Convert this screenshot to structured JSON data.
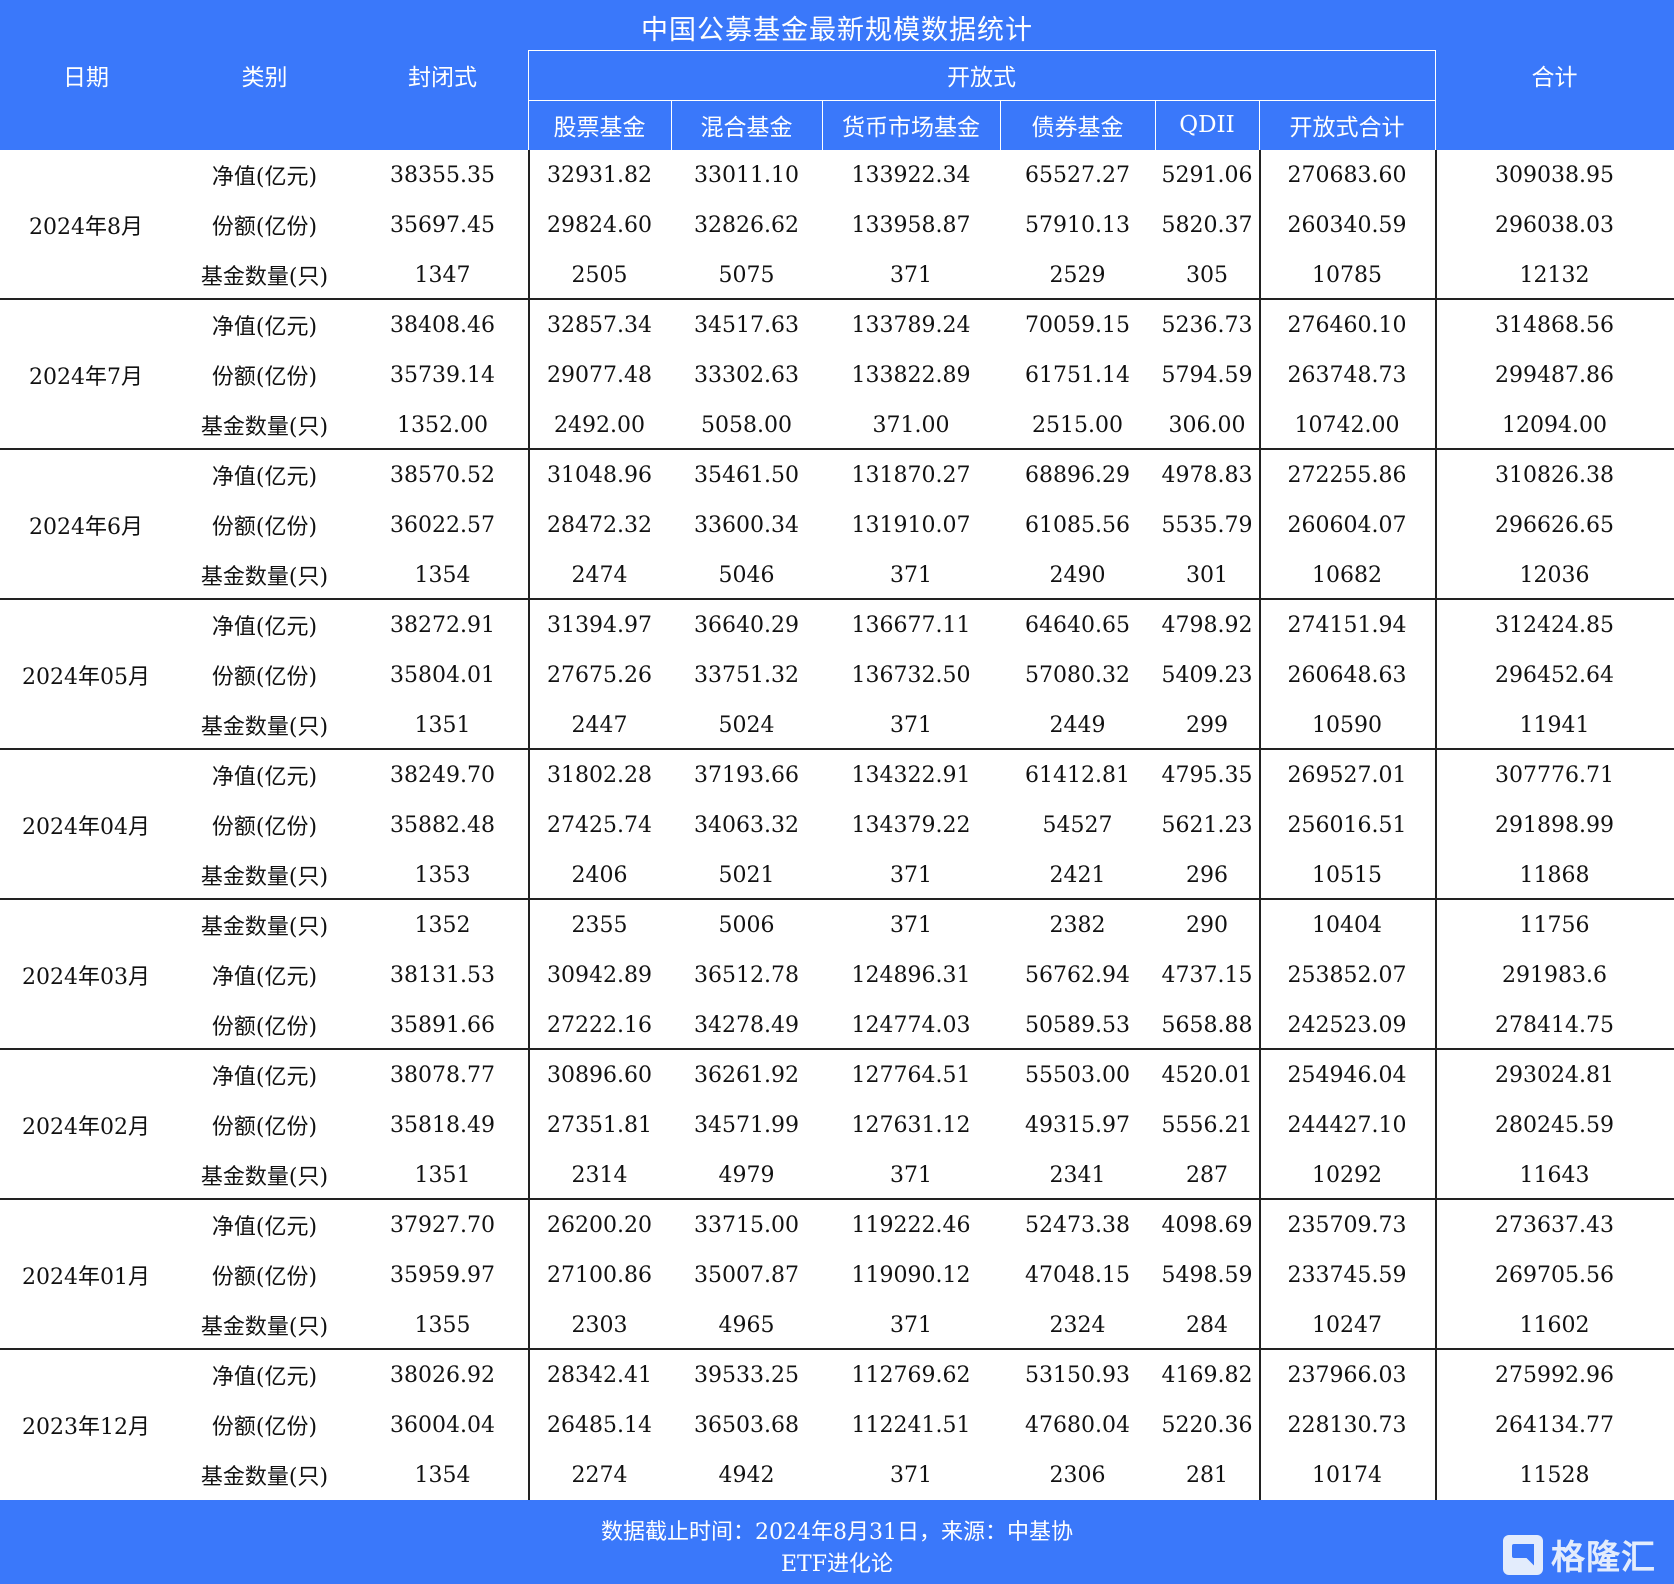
{
  "title": "中国公募基金最新规模数据统计",
  "header": {
    "date": "日期",
    "category": "类别",
    "closed": "封闭式",
    "open": "开放式",
    "total": "合计",
    "open_sub": [
      "股票基金",
      "混合基金",
      "货币市场基金",
      "债券基金",
      "QDII",
      "开放式合计"
    ]
  },
  "groups": [
    {
      "date": "2024年8月",
      "rows": [
        {
          "cat": "净值(亿元)",
          "vals": [
            "38355.35",
            "32931.82",
            "33011.10",
            "133922.34",
            "65527.27",
            "5291.06",
            "270683.60",
            "309038.95"
          ]
        },
        {
          "cat": "份额(亿份)",
          "vals": [
            "35697.45",
            "29824.60",
            "32826.62",
            "133958.87",
            "57910.13",
            "5820.37",
            "260340.59",
            "296038.03"
          ]
        },
        {
          "cat": "基金数量(只)",
          "vals": [
            "1347",
            "2505",
            "5075",
            "371",
            "2529",
            "305",
            "10785",
            "12132"
          ]
        }
      ]
    },
    {
      "date": "2024年7月",
      "rows": [
        {
          "cat": "净值(亿元)",
          "vals": [
            "38408.46",
            "32857.34",
            "34517.63",
            "133789.24",
            "70059.15",
            "5236.73",
            "276460.10",
            "314868.56"
          ]
        },
        {
          "cat": "份额(亿份)",
          "vals": [
            "35739.14",
            "29077.48",
            "33302.63",
            "133822.89",
            "61751.14",
            "5794.59",
            "263748.73",
            "299487.86"
          ]
        },
        {
          "cat": "基金数量(只)",
          "vals": [
            "1352.00",
            "2492.00",
            "5058.00",
            "371.00",
            "2515.00",
            "306.00",
            "10742.00",
            "12094.00"
          ]
        }
      ]
    },
    {
      "date": "2024年6月",
      "rows": [
        {
          "cat": "净值(亿元)",
          "vals": [
            "38570.52",
            "31048.96",
            "35461.50",
            "131870.27",
            "68896.29",
            "4978.83",
            "272255.86",
            "310826.38"
          ]
        },
        {
          "cat": "份额(亿份)",
          "vals": [
            "36022.57",
            "28472.32",
            "33600.34",
            "131910.07",
            "61085.56",
            "5535.79",
            "260604.07",
            "296626.65"
          ]
        },
        {
          "cat": "基金数量(只)",
          "vals": [
            "1354",
            "2474",
            "5046",
            "371",
            "2490",
            "301",
            "10682",
            "12036"
          ]
        }
      ]
    },
    {
      "date": "2024年05月",
      "rows": [
        {
          "cat": "净值(亿元)",
          "vals": [
            "38272.91",
            "31394.97",
            "36640.29",
            "136677.11",
            "64640.65",
            "4798.92",
            "274151.94",
            "312424.85"
          ]
        },
        {
          "cat": "份额(亿份)",
          "vals": [
            "35804.01",
            "27675.26",
            "33751.32",
            "136732.50",
            "57080.32",
            "5409.23",
            "260648.63",
            "296452.64"
          ]
        },
        {
          "cat": "基金数量(只)",
          "vals": [
            "1351",
            "2447",
            "5024",
            "371",
            "2449",
            "299",
            "10590",
            "11941"
          ]
        }
      ]
    },
    {
      "date": "2024年04月",
      "rows": [
        {
          "cat": "净值(亿元)",
          "vals": [
            "38249.70",
            "31802.28",
            "37193.66",
            "134322.91",
            "61412.81",
            "4795.35",
            "269527.01",
            "307776.71"
          ]
        },
        {
          "cat": "份额(亿份)",
          "vals": [
            "35882.48",
            "27425.74",
            "34063.32",
            "134379.22",
            "54527",
            "5621.23",
            "256016.51",
            "291898.99"
          ]
        },
        {
          "cat": "基金数量(只)",
          "vals": [
            "1353",
            "2406",
            "5021",
            "371",
            "2421",
            "296",
            "10515",
            "11868"
          ]
        }
      ]
    },
    {
      "date": "2024年03月",
      "rows": [
        {
          "cat": "基金数量(只)",
          "vals": [
            "1352",
            "2355",
            "5006",
            "371",
            "2382",
            "290",
            "10404",
            "11756"
          ]
        },
        {
          "cat": "净值(亿元)",
          "vals": [
            "38131.53",
            "30942.89",
            "36512.78",
            "124896.31",
            "56762.94",
            "4737.15",
            "253852.07",
            "291983.6"
          ]
        },
        {
          "cat": "份额(亿份)",
          "vals": [
            "35891.66",
            "27222.16",
            "34278.49",
            "124774.03",
            "50589.53",
            "5658.88",
            "242523.09",
            "278414.75"
          ]
        }
      ]
    },
    {
      "date": "2024年02月",
      "rows": [
        {
          "cat": "净值(亿元)",
          "vals": [
            "38078.77",
            "30896.60",
            "36261.92",
            "127764.51",
            "55503.00",
            "4520.01",
            "254946.04",
            "293024.81"
          ]
        },
        {
          "cat": "份额(亿份)",
          "vals": [
            "35818.49",
            "27351.81",
            "34571.99",
            "127631.12",
            "49315.97",
            "5556.21",
            "244427.10",
            "280245.59"
          ]
        },
        {
          "cat": "基金数量(只)",
          "vals": [
            "1351",
            "2314",
            "4979",
            "371",
            "2341",
            "287",
            "10292",
            "11643"
          ]
        }
      ]
    },
    {
      "date": "2024年01月",
      "rows": [
        {
          "cat": "净值(亿元)",
          "vals": [
            "37927.70",
            "26200.20",
            "33715.00",
            "119222.46",
            "52473.38",
            "4098.69",
            "235709.73",
            "273637.43"
          ]
        },
        {
          "cat": "份额(亿份)",
          "vals": [
            "35959.97",
            "27100.86",
            "35007.87",
            "119090.12",
            "47048.15",
            "5498.59",
            "233745.59",
            "269705.56"
          ]
        },
        {
          "cat": "基金数量(只)",
          "vals": [
            "1355",
            "2303",
            "4965",
            "371",
            "2324",
            "284",
            "10247",
            "11602"
          ]
        }
      ]
    },
    {
      "date": "2023年12月",
      "rows": [
        {
          "cat": "净值(亿元)",
          "vals": [
            "38026.92",
            "28342.41",
            "39533.25",
            "112769.62",
            "53150.93",
            "4169.82",
            "237966.03",
            "275992.96"
          ]
        },
        {
          "cat": "份额(亿份)",
          "vals": [
            "36004.04",
            "26485.14",
            "36503.68",
            "112241.51",
            "47680.04",
            "5220.36",
            "228130.73",
            "264134.77"
          ]
        },
        {
          "cat": "基金数量(只)",
          "vals": [
            "1354",
            "2274",
            "4942",
            "371",
            "2306",
            "281",
            "10174",
            "11528"
          ]
        }
      ]
    }
  ],
  "footer": {
    "note": "数据截止时间：2024年8月31日，来源：中基协",
    "author": "ETF进化论",
    "logo_text": "格隆汇"
  },
  "colors": {
    "header_bg": "#3a78fa",
    "header_text": "#ffffff",
    "grid_line": "#222222"
  }
}
